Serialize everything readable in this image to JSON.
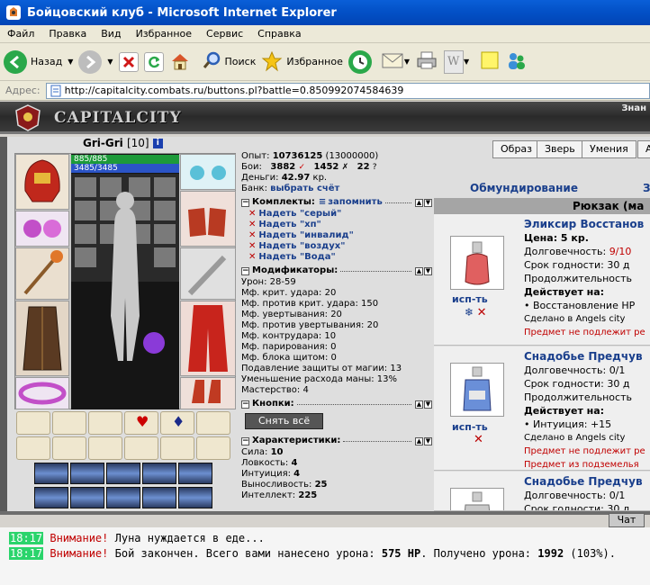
{
  "window": {
    "title": "Бойцовский клуб - Microsoft Internet Explorer"
  },
  "menu": [
    "Файл",
    "Правка",
    "Вид",
    "Избранное",
    "Сервис",
    "Справка"
  ],
  "toolbar": {
    "back": "Назад",
    "search": "Поиск",
    "favorites": "Избранное"
  },
  "address": {
    "label": "Адрес:",
    "url": "http://capitalcity.combats.ru/buttons.pl?battle=0.850992074584639"
  },
  "banner": {
    "logo": "CAPITALCITY",
    "right_text": "Знан"
  },
  "character": {
    "name": "Gri-Gri",
    "level": "[10]",
    "info_icon": "i",
    "hp": "885/885",
    "mana": "3485/3485"
  },
  "stats": {
    "experience": {
      "label": "Опыт:",
      "value": "10736125",
      "max": "(13000000)"
    },
    "battles": {
      "label": "Бои:",
      "wins": "3882",
      "losses": "1452",
      "draws": "22"
    },
    "money": {
      "label": "Деньги:",
      "value": "42.97",
      "unit": "кр."
    },
    "bank": {
      "label": "Банк:",
      "link": "выбрать счёт"
    },
    "sets": {
      "title": "Комплекты:",
      "remember": "запомнить",
      "items": [
        "Надеть \"серый\"",
        "Надеть \"хп\"",
        "Надеть \"инвалид\"",
        "Надеть \"воздух\"",
        "Надеть \"Вода\""
      ]
    },
    "modifiers": {
      "title": "Модификаторы:",
      "items": [
        "Урон: 28-59",
        "Мф. крит. удара: 20",
        "Мф. против крит. удара: 150",
        "Мф. увертывания: 20",
        "Мф. против увертывания: 20",
        "Мф. контрудара: 10",
        "Мф. парирования: 0",
        "Мф. блока щитом: 0",
        "Подавление защиты от магии: 13",
        "Уменьшение расхода маны: 13%",
        "Мастерство: 4"
      ]
    },
    "buttons": {
      "title": "Кнопки:",
      "remove_all": "Снять всё"
    },
    "characteristics": {
      "title": "Характеристики:",
      "items": [
        {
          "label": "Сила:",
          "value": "10"
        },
        {
          "label": "Ловкость:",
          "value": "4"
        },
        {
          "label": "Интуиция:",
          "value": "4"
        },
        {
          "label": "Выносливость:",
          "value": "25"
        },
        {
          "label": "Интеллект:",
          "value": "225"
        }
      ]
    }
  },
  "top_buttons": [
    "Образ",
    "Зверь",
    "Умения",
    "А"
  ],
  "tabs": {
    "outfit": "Обмундирование",
    "other": "З"
  },
  "backpack": {
    "title": "Рюкзак (ма",
    "items": [
      {
        "name": "Эликсир Восстанов",
        "price_label": "Цена: 5 кр.",
        "durability_label": "Долговечность:",
        "durability_value": "9/10",
        "expiry": "Срок годности: 30 д",
        "duration": "Продолжительность",
        "acts_on": "Действует на:",
        "effect": "Восстановление НР",
        "made_in": "Сделано в Angels city",
        "note1": "Предмет не подлежит ре",
        "note2": "",
        "use": "исп-ть"
      },
      {
        "name": "Снадобье Предчув",
        "price_label": "",
        "durability_label": "Долговечность:",
        "durability_value": "0/1",
        "expiry": "Срок годности: 30 д",
        "duration": "Продолжительность",
        "acts_on": "Действует на:",
        "effect": "Интуиция: +15",
        "made_in": "Сделано в Angels city",
        "note1": "Предмет не подлежит ре",
        "note2": "Предмет из подземелья",
        "use": "исп-ть"
      },
      {
        "name": "Снадобье Предчув",
        "durability_label": "Долговечность:",
        "durability_value": "0/1",
        "expiry": "Срок годности: 30 д"
      }
    ]
  },
  "chat": {
    "tab": "Чат",
    "messages": [
      {
        "time": "18:17",
        "warn": "Внимание!",
        "text": "Луна нуждается в еде..."
      },
      {
        "time": "18:17",
        "warn": "Внимание!",
        "text_a": "Бой закончен. Всего вами нанесено урона:",
        "dmg": "575 HP",
        "text_b": ". Получено урона:",
        "recv": "1992",
        "text_c": "(103%)."
      }
    ]
  },
  "colors": {
    "title_blue": "#0351c7",
    "hp_green": "#1d9a3a",
    "mana_blue": "#2b54c6",
    "link_blue": "#1a3f8c",
    "warn_red": "#c00000",
    "chat_time_green": "#2ad46b"
  }
}
